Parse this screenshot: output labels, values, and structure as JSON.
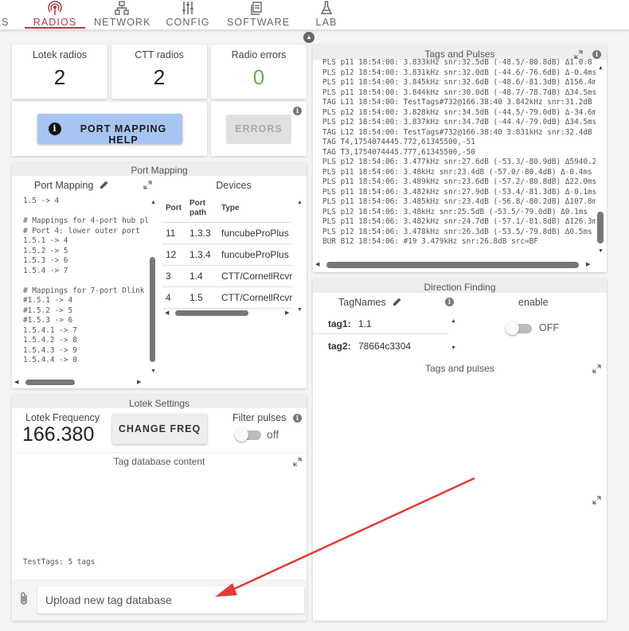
{
  "nav": {
    "tabs": [
      {
        "label": "ES",
        "icon": "partial-tab-icon"
      },
      {
        "label": "RADIOS",
        "icon": "radio-tower-icon"
      },
      {
        "label": "NETWORK",
        "icon": "network-icon"
      },
      {
        "label": "CONFIG",
        "icon": "sliders-icon"
      },
      {
        "label": "SOFTWARE",
        "icon": "software-icon"
      },
      {
        "label": "LAB",
        "icon": "flask-icon"
      }
    ],
    "active_tab": "RADIOS",
    "accent": "#b23a48"
  },
  "stats": {
    "lotek": {
      "label": "Lotek radios",
      "value": "2"
    },
    "ctt": {
      "label": "CTT radios",
      "value": "2"
    },
    "errors": {
      "label": "Radio errors",
      "value": "0",
      "color": "#6aaa5a"
    }
  },
  "buttons": {
    "port_mapping_help": "PORT MAPPING HELP",
    "errors": "ERRORS",
    "change_freq": "CHANGE FREQ"
  },
  "port_mapping": {
    "section_title": "Port Mapping",
    "panel_title": "Port Mapping",
    "lines": [
      "1.5 -> 4",
      "",
      "# Mappings for 4-port hub pl",
      "# Port 4: lower outer port",
      "1.5.1 -> 4",
      "1.5.2 -> 5",
      "1.5.3 -> 6",
      "1.5.4 -> 7",
      "",
      "# Mappings for 7-port Dlink",
      "#1.5.1 -> 4",
      "#1.5.2 -> 5",
      "#1.5.3 -> 6",
      "1.5.4.1 -> 7",
      "1.5.4.2 -> 8",
      "1.5.4.3 -> 9",
      "1.5.4.4 -> 0"
    ]
  },
  "devices": {
    "title": "Devices",
    "headers": [
      "Port",
      "Port path",
      "Type"
    ],
    "rows": [
      [
        "11",
        "1.3.3",
        "funcubeProPlus"
      ],
      [
        "12",
        "1.3.4",
        "funcubeProPlus"
      ],
      [
        "3",
        "1.4",
        "CTT/CornellRcvr"
      ],
      [
        "4",
        "1.5",
        "CTT/CornellRcvr"
      ]
    ]
  },
  "lotek_settings": {
    "title": "Lotek Settings",
    "freq_label": "Lotek Frequency",
    "freq_value": "166.380",
    "filter_label": "Filter pulses",
    "filter_state": "off"
  },
  "tag_db": {
    "title": "Tag database content",
    "content": "TestTags: 5 tags",
    "upload_placeholder": "Upload new tag database"
  },
  "tags_pulses": {
    "title": "Tags and Pulses",
    "lines": [
      "PLS p11 18:54:00: 3.833kHz snr:32.5dB (-48.5/-80.8dB) Δ1.0.8",
      "PLS p12 18:54:00: 3.831kHz snr:32.0dB (-44.6/-76.6dB) Δ-0.4ms",
      "PLS p11 18:54:00: 3.845kHz snr:32.6dB (-48.6/-81.3dB) Δ156.4m",
      "PLS p11 18:54:00: 3.844kHz snr:30.0dB (-48.7/-78.7dB) Δ34.5ms",
      "TAG L11 18:54:00: TestTags#732@166.38:40 3.842kHz snr:31.2dB",
      "PLS p12 18:54:00: 3.828kHz snr:34.5dB (-44.5/-79.0dB) Δ-34.6m",
      "PLS p12 18:54:00: 3.837kHz snr:34.7dB (-44.4/-79.0dB) Δ34.5ms",
      "TAG L12 18:54:00: TestTags#732@166.38:40 3.831kHz snr:32.4dB",
      "TAG T4,1754074445.772,61345500,-51",
      "TAG T3,1754074445.777,61345500,-50",
      "PLS p12 18:54:06: 3.477kHz snr:27.6dB (-53.3/-80.9dB) Δ5940.2",
      "PLS p11 18:54:06: 3.48kHz snr:23.4dB (-57.0/-80.4dB) Δ-0.4ms",
      "PLS p11 18:54:06: 3.489kHz snr:23.6dB (-57.2/-80.8dB) Δ22.0ms",
      "PLS p11 18:54:06: 3.482kHz snr:27.9dB (-53.4/-81.3dB) Δ-0.1ms",
      "PLS p11 18:54:06: 3.485kHz snr:23.4dB (-56.8/-80.2dB) Δ107.8m",
      "PLS p12 18:54:06: 3.48kHz snr:25.5dB (-53.5/-79.0dB) Δ0.1ms",
      "PLS p11 18:54:06: 3.482kHz snr:24.7dB (-57.1/-81.8dB) Δ126.3m",
      "PLS p12 18:54:06: 3.478kHz snr:26.3dB (-53.5/-79.8dB) Δ0.5ms",
      "BUR B12 18:54:06: #19 3.479kHz snr:26.8dB src=BF"
    ]
  },
  "direction_finding": {
    "title": "Direction Finding",
    "tagnames_label": "TagNames",
    "enable_label": "enable",
    "enable_state": "OFF",
    "tags": [
      {
        "key": "tag1:",
        "value": "1.1"
      },
      {
        "key": "tag2:",
        "value": "78664c3304"
      }
    ],
    "tags_pulses_title": "Tags and pulses"
  }
}
